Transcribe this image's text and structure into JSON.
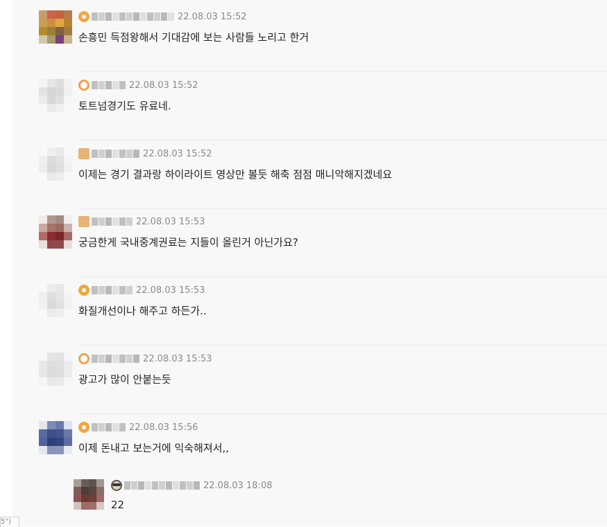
{
  "comments": [
    {
      "time": "22.08.03 15:52",
      "text": "손흥민 득점왕해서 기대감에 보는 사람들 노리고 한거",
      "badge": "orange",
      "avatar": [
        "#c79a6a",
        "#d0614a",
        "#c86040",
        "#b57a4d",
        "#c4a24f",
        "#c9913f",
        "#e0a640",
        "#b5822f",
        "#b28d30",
        "#9c7f36",
        "#7e6043",
        "#9e7b3e",
        "#d2c8b0",
        "#a79b6a",
        "#7a3f7e",
        "#c9b490"
      ]
    },
    {
      "time": "22.08.03 15:52",
      "text": "토트넘경기도 유료네.",
      "badge": "orange2",
      "avatar": [
        "#f4f4f4",
        "#e6e6e6",
        "#dedede",
        "#f2f2f2",
        "#e3e3e3",
        "#d6d6d6",
        "#d9d9d9",
        "#efefef",
        "#ececec",
        "#d8d8d8",
        "#e0e0e0",
        "#f5f5f5",
        "#f7f7f7",
        "#eaeaea",
        "#f0f0f0",
        "#f8f8f8"
      ]
    },
    {
      "time": "22.08.03 15:52",
      "text": "이제는 경기 결과랑 하이라이트 영상만 볼듯 해축 점점 매니악해지겠네요",
      "badge": "tan",
      "avatar": [
        "#f8f8f8",
        "#efefef",
        "#e8e8e8",
        "#f8f8f8",
        "#f0f0f0",
        "#dcdcdc",
        "#e2e2e2",
        "#f3f3f3",
        "#eeeeee",
        "#d9d9d9",
        "#dfdfdf",
        "#f1f1f1",
        "#f8f8f8",
        "#e9e9e9",
        "#ededed",
        "#f8f8f8"
      ]
    },
    {
      "time": "22.08.03 15:53",
      "text": "궁금한게 국내중계권료는 지들이 올린거 아닌가요?",
      "badge": "tan",
      "avatar": [
        "#f0ebe8",
        "#b39891",
        "#a78b86",
        "#f2eeec",
        "#c9a9a3",
        "#a6746d",
        "#9b6a63",
        "#c8b2ad",
        "#b26c66",
        "#8d2a2d",
        "#7b2527",
        "#a86965",
        "#e9dfdd",
        "#8f4a4c",
        "#914b4d",
        "#e8dcdb"
      ]
    },
    {
      "time": "22.08.03 15:53",
      "text": "화질개선이나 해주고 하든가..",
      "badge": "orange",
      "avatar": [
        "#f8f8f8",
        "#ececec",
        "#e8e8e8",
        "#f8f8f8",
        "#efefef",
        "#dedede",
        "#e4e4e4",
        "#f3f3f3",
        "#f0f0f0",
        "#dadada",
        "#e1e1e1",
        "#f2f2f2",
        "#f8f8f8",
        "#ebebeb",
        "#eeeeee",
        "#f8f8f8"
      ]
    },
    {
      "time": "22.08.03 15:53",
      "text": "광고가 많이 안붙는듯",
      "badge": "orange2",
      "avatar": [
        "#f8f8f8",
        "#e6e6e6",
        "#e3e3e3",
        "#f6f6f6",
        "#e9e9e9",
        "#dddddd",
        "#dfdfdf",
        "#ececec",
        "#e7e7e7",
        "#dbdbdb",
        "#dddddd",
        "#ebebeb",
        "#f5f5f5",
        "#e8e8e8",
        "#eaeaea",
        "#f7f7f7"
      ]
    },
    {
      "time": "22.08.03 15:56",
      "text": "이제 돈내고 보는거에 익숙해져서,,",
      "badge": "orange",
      "avatar": [
        "#e3e6ef",
        "#7d8ab3",
        "#6a7aab",
        "#dfe3ee",
        "#5a6aa0",
        "#3f4f8c",
        "#44558f",
        "#6b79a8",
        "#52629b",
        "#2f3f7a",
        "#34467f",
        "#5f6ea2",
        "#e6e8f0",
        "#8793b8",
        "#8b96ba",
        "#e8eaf1"
      ]
    }
  ],
  "reply": {
    "time": "22.08.03 18:08",
    "text": "22",
    "badge": "mask",
    "avatar": [
      "#a89e98",
      "#6a5e58",
      "#5d5450",
      "#a29893",
      "#7d5f57",
      "#4c3d39",
      "#5a4540",
      "#8a6d65",
      "#8e5550",
      "#6a3835",
      "#70403b",
      "#9a6a63",
      "#cfc6c3",
      "#a16a66",
      "#a4706b",
      "#d3cac7"
    ]
  },
  "corner_tag": "5\")"
}
